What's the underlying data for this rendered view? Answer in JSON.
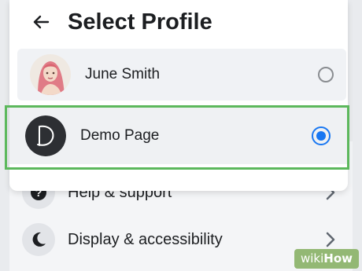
{
  "header": {
    "title": "Select Profile",
    "back_icon": "arrow-left-icon"
  },
  "profiles": [
    {
      "name": "June Smith",
      "avatar": "photo",
      "selected": false
    },
    {
      "name": "Demo Page",
      "avatar_letter": "D",
      "selected": true
    }
  ],
  "menu": {
    "items": [
      {
        "label": "Help & support",
        "icon": "question-icon"
      },
      {
        "label": "Display & accessibility",
        "icon": "moon-icon"
      }
    ]
  },
  "watermark": {
    "wiki": "wiki",
    "how": "How"
  },
  "colors": {
    "accent": "#1877f2",
    "highlight": "#5cb85c",
    "background": "#e9ebee"
  }
}
